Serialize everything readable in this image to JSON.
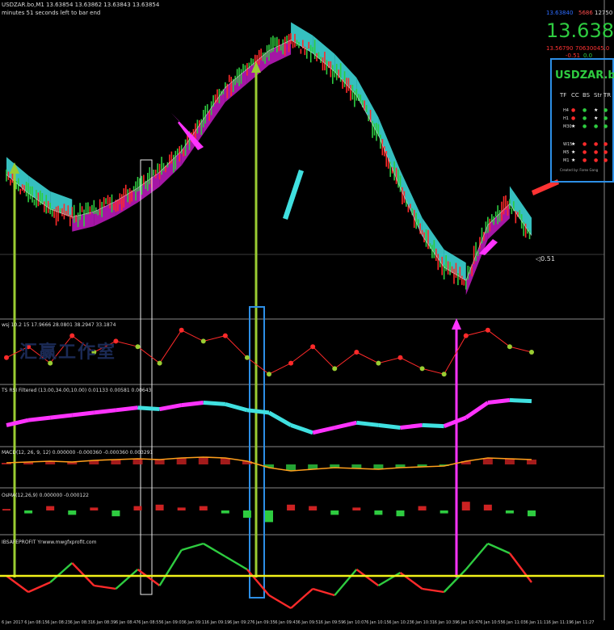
{
  "chart_data": {
    "type": "line",
    "title": "USDZAR.bo,M1 13.63854 13.63862 13.63843 13.63854",
    "subtitle": "minutes 51 seconds left to bar end",
    "price": "13.63854",
    "top_quotes": {
      "bid": "13.63840",
      "ask": "5686",
      "extra": "12750",
      "low_label": "13.56790",
      "high_label": "70630045.0",
      "r1": "-0.51",
      "r2": "0.0"
    },
    "price_mark": "0.51",
    "watermark": "汇赢工作室",
    "panels": [
      {
        "name": "price",
        "label": ""
      },
      {
        "name": "osc1",
        "label": "wsj 10.2 15 17.9666 28.0801 38.2947 33.1874"
      },
      {
        "name": "osc2",
        "label": "TS RSI Filtered (13.00,34.00,10.00) 0.01133 0.00581 0.00643"
      },
      {
        "name": "macd",
        "label": "MACD(12, 26, 9, 12) 0.000000 -0.000360 -0.000360 0.003291"
      },
      {
        "name": "osma",
        "label": "OsMA(12,26,9) 0.000000 -0.000122"
      },
      {
        "name": "profit",
        "label": "IBSAFEPROFIT Yrwww.mwgfxprofit.com"
      }
    ],
    "ticker_panel": {
      "symbol": "USDZAR.bo",
      "columns": [
        "TF",
        "CC",
        "BS",
        "Str",
        "TR"
      ],
      "rows": [
        {
          "tf": "H4",
          "cells": [
            "red",
            "green",
            "white",
            "green"
          ]
        },
        {
          "tf": "H1",
          "cells": [
            "red",
            "green",
            "white",
            "green"
          ]
        },
        {
          "tf": "M30",
          "cells": [
            "white",
            "green",
            "green",
            "green"
          ]
        },
        {
          "tf": "W15",
          "cells": [
            "white",
            "red",
            "red",
            "red"
          ]
        },
        {
          "tf": "M5",
          "cells": [
            "white",
            "red",
            "red",
            "red"
          ]
        },
        {
          "tf": "M1",
          "cells": [
            "white",
            "red",
            "red",
            "red"
          ]
        }
      ],
      "author": "Created by: Forex Gang"
    },
    "x_labels": [
      "6 Jan 2017",
      "6 Jan 08:15",
      "6 Jan 08:23",
      "6 Jan 08:31",
      "6 Jan 08:39",
      "6 Jan 08:47",
      "6 Jan 08:55",
      "6 Jan 09:03",
      "6 Jan 09:11",
      "6 Jan 09:19",
      "6 Jan 09:27",
      "6 Jan 09:35",
      "6 Jan 09:43",
      "6 Jan 09:51",
      "6 Jan 09:59",
      "6 Jan 10:07",
      "6 Jan 10:15",
      "6 Jan 10:23",
      "6 Jan 10:31",
      "6 Jan 10:39",
      "6 Jan 10:47",
      "6 Jan 10:55",
      "6 Jan 11:03",
      "6 Jan 11:11",
      "6 Jan 11:19",
      "6 Jan 11:27"
    ],
    "series": [
      {
        "values": [
          13.625,
          13.618,
          13.612,
          13.609,
          13.611,
          13.615,
          13.62,
          13.626,
          13.634,
          13.646,
          13.658,
          13.665,
          13.672,
          13.676,
          13.671,
          13.664,
          13.655,
          13.64,
          13.62,
          13.602,
          13.59,
          13.585,
          13.606,
          13.614,
          13.602
        ]
      }
    ],
    "oscillators": {
      "osc1": [
        0.4,
        0.6,
        0.3,
        0.8,
        0.5,
        0.7,
        0.6,
        0.3,
        0.9,
        0.7,
        0.8,
        0.4,
        0.1,
        0.3,
        0.6,
        0.2,
        0.5,
        0.3,
        0.4,
        0.2,
        0.1,
        0.8,
        0.9,
        0.6,
        0.5
      ],
      "osc2": [
        0.3,
        0.4,
        0.45,
        0.5,
        0.55,
        0.6,
        0.65,
        0.62,
        0.7,
        0.75,
        0.72,
        0.6,
        0.55,
        0.3,
        0.15,
        0.25,
        0.35,
        0.3,
        0.25,
        0.3,
        0.28,
        0.45,
        0.75,
        0.8,
        0.78
      ],
      "macd": [
        0.1,
        0.15,
        0.2,
        0.15,
        0.25,
        0.3,
        0.35,
        0.3,
        0.4,
        0.45,
        0.4,
        0.2,
        -0.2,
        -0.4,
        -0.3,
        -0.2,
        -0.25,
        -0.3,
        -0.2,
        -0.15,
        -0.1,
        0.2,
        0.4,
        0.35,
        0.3
      ],
      "osma": [
        0.1,
        -0.2,
        0.3,
        -0.3,
        0.2,
        -0.4,
        0.3,
        0.4,
        0.2,
        0.3,
        -0.2,
        -0.5,
        -0.8,
        0.4,
        0.3,
        -0.3,
        0.2,
        -0.3,
        -0.4,
        0.3,
        -0.2,
        0.6,
        0.4,
        -0.2,
        -0.4
      ],
      "profit": [
        0.0,
        -0.5,
        -0.2,
        0.4,
        -0.3,
        -0.4,
        0.2,
        -0.3,
        0.8,
        1.0,
        0.6,
        0.2,
        -0.6,
        -1.0,
        -0.4,
        -0.6,
        0.2,
        -0.3,
        0.1,
        -0.4,
        -0.5,
        0.2,
        1.0,
        0.7,
        -0.2
      ]
    }
  }
}
